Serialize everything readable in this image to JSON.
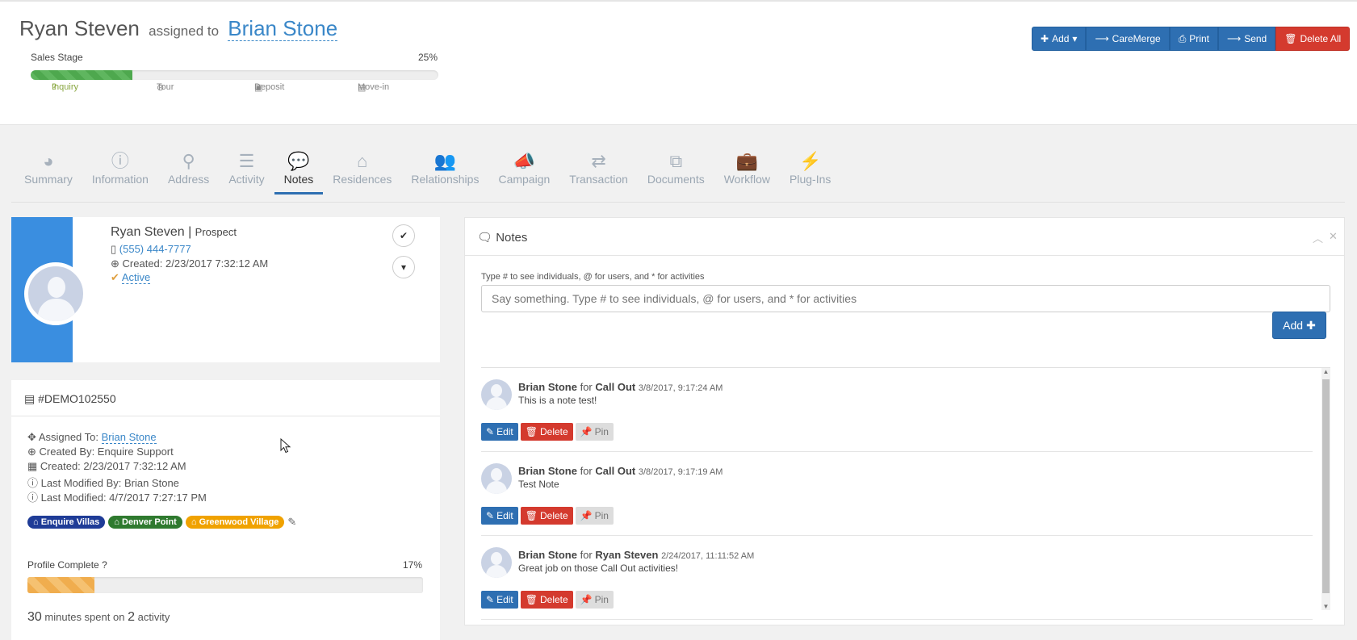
{
  "header": {
    "name": "Ryan Steven",
    "assigned_text": "assigned to",
    "assignee": "Brian Stone",
    "sales_stage_label": "Sales Stage",
    "sales_stage_pct": "25%",
    "sales_stage_value": 0.25,
    "stages": [
      {
        "label": "Inquiry",
        "icon": "question-icon"
      },
      {
        "label": "Tour",
        "icon": "clock-icon"
      },
      {
        "label": "Deposit",
        "icon": "money-icon"
      },
      {
        "label": "Move-in",
        "icon": "briefcase-icon"
      }
    ],
    "buttons": {
      "add": "Add",
      "caremerge": "CareMerge",
      "print": "Print",
      "send": "Send",
      "delete_all": "Delete All"
    }
  },
  "tabs": [
    {
      "label": "Summary",
      "icon": "dashboard-icon"
    },
    {
      "label": "Information",
      "icon": "info-icon"
    },
    {
      "label": "Address",
      "icon": "map-marker-icon"
    },
    {
      "label": "Activity",
      "icon": "server-icon"
    },
    {
      "label": "Notes",
      "icon": "comments-icon",
      "active": true
    },
    {
      "label": "Residences",
      "icon": "home-icon"
    },
    {
      "label": "Relationships",
      "icon": "users-icon"
    },
    {
      "label": "Campaign",
      "icon": "bullhorn-icon"
    },
    {
      "label": "Transaction",
      "icon": "exchange-icon"
    },
    {
      "label": "Documents",
      "icon": "files-icon"
    },
    {
      "label": "Workflow",
      "icon": "briefcase-icon"
    },
    {
      "label": "Plug-Ins",
      "icon": "plug-icon"
    }
  ],
  "profile": {
    "name": "Ryan Steven",
    "separator": "|",
    "type": "Prospect",
    "phone": "(555) 444-7777",
    "created": "Created: 2/23/2017 7:32:12 AM",
    "status": "Active"
  },
  "detail": {
    "id": "#DEMO102550",
    "assigned_to_label": "Assigned To:",
    "assigned_to": "Brian Stone",
    "created_by": "Created By: Enquire Support",
    "created": "Created: 2/23/2017 7:32:12 AM",
    "last_modified_by": "Last Modified By: Brian Stone",
    "last_modified": "Last Modified: 4/7/2017 7:27:17 PM",
    "tags": [
      "Enquire Villas",
      "Denver Point",
      "Greenwood Village"
    ],
    "tag_colors": [
      "#1f3c97",
      "#2f7a2f",
      "#f0a200"
    ],
    "profile_complete_label": "Profile Complete",
    "profile_complete_pct": "17%",
    "profile_complete_value": 0.17,
    "minutes": "30",
    "minutes_text": "minutes spent on",
    "activities": "2",
    "activity_text": "activity"
  },
  "notes": {
    "title": "Notes",
    "hint": "Type # to see individuals, @ for users, and * for activities",
    "placeholder": "Say something. Type # to see individuals, @ for users, and * for activities",
    "add_label": "Add",
    "edit_label": "Edit",
    "delete_label": "Delete",
    "pin_label": "Pin",
    "items": [
      {
        "author": "Brian Stone",
        "for": "for",
        "target": "Call Out",
        "time": "3/8/2017, 9:17:24 AM",
        "text": "This is a note test!"
      },
      {
        "author": "Brian Stone",
        "for": "for",
        "target": "Call Out",
        "time": "3/8/2017, 9:17:19 AM",
        "text": "Test Note"
      },
      {
        "author": "Brian Stone",
        "for": "for",
        "target": "Ryan Steven",
        "time": "2/24/2017, 11:11:52 AM",
        "text": "Great job on those Call Out activities!"
      }
    ]
  },
  "colors": {
    "primary": "#2e6fb2",
    "danger": "#d43a2e",
    "success": "#5fb65f",
    "warning": "#f0ad4e",
    "stripe": "#3a8ee0"
  }
}
